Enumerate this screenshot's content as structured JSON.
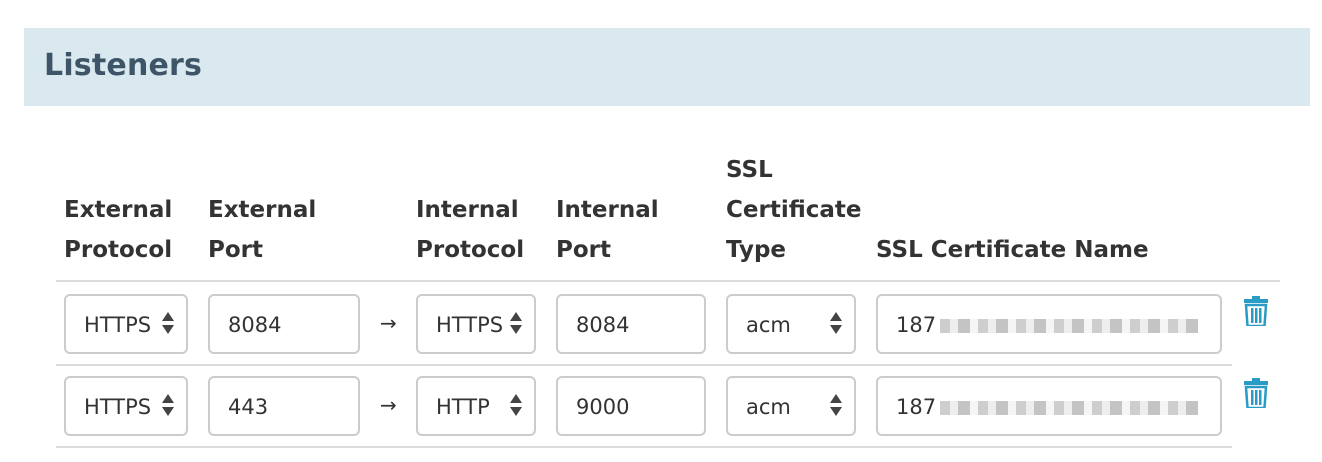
{
  "section": {
    "title": "Listeners"
  },
  "table": {
    "headers": {
      "external_protocol": [
        "External",
        "Protocol"
      ],
      "external_port": [
        "External",
        "Port"
      ],
      "internal_protocol": [
        "Internal",
        "Protocol"
      ],
      "internal_port": [
        "Internal",
        "Port"
      ],
      "ssl_cert_type": [
        "SSL",
        "Certificate",
        "Type"
      ],
      "ssl_cert_name": [
        "SSL Certificate Name"
      ]
    },
    "rows": [
      {
        "external_protocol": "HTTPS",
        "external_port": "8084",
        "arrow": "→",
        "internal_protocol": "HTTPS",
        "internal_port": "8084",
        "ssl_cert_type": "acm",
        "ssl_cert_name": "187"
      },
      {
        "external_protocol": "HTTPS",
        "external_port": "443",
        "arrow": "→",
        "internal_protocol": "HTTP",
        "internal_port": "9000",
        "ssl_cert_type": "acm",
        "ssl_cert_name": "187"
      }
    ]
  },
  "colors": {
    "header_bg": "#d9e9ef",
    "title": "#3d5567",
    "trash_icon": "#2a9bc4"
  },
  "icons": {
    "delete": "trash-icon",
    "select": "updown-arrows-icon",
    "mapping": "right-arrow-icon"
  }
}
